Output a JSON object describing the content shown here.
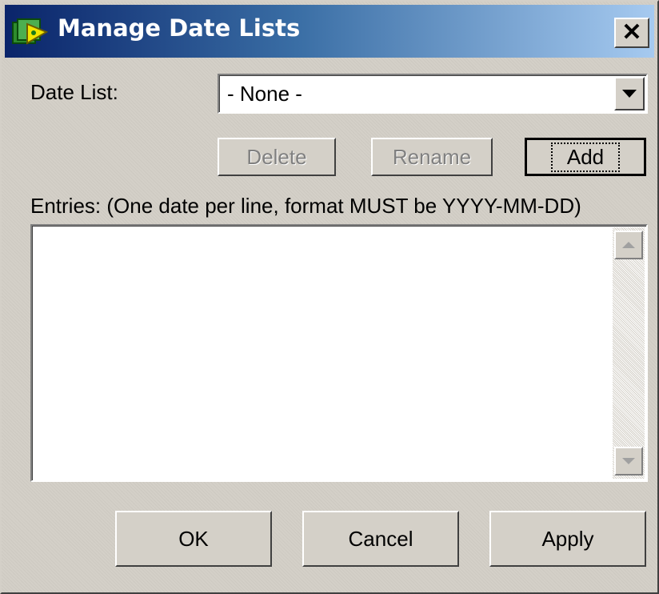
{
  "window": {
    "title": "Manage Date Lists",
    "close_label": "✕",
    "title_icon": "date-list-app-icon",
    "close_icon": "close-icon",
    "title_gradient_start": "#0a246a",
    "title_gradient_end": "#a6caf0"
  },
  "date_list": {
    "label": "Date List:",
    "selected": "- None -",
    "dropdown_icon": "chevron-down-icon"
  },
  "actions": {
    "delete_label": "Delete",
    "rename_label": "Rename",
    "add_label": "Add"
  },
  "entries": {
    "label": "Entries: (One date per line, format MUST be YYYY-MM-DD)",
    "value": ""
  },
  "footer": {
    "ok_label": "OK",
    "cancel_label": "Cancel",
    "apply_label": "Apply"
  }
}
